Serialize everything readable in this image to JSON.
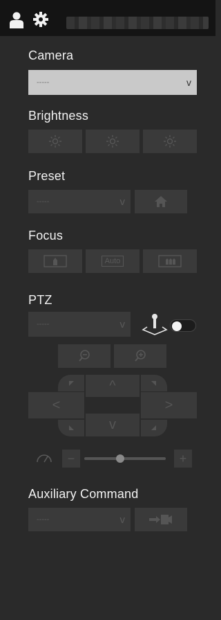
{
  "header": {
    "user_icon": "user-icon",
    "settings_icon": "gear-icon"
  },
  "camera": {
    "label": "Camera",
    "selected": "-----",
    "chevron": "v"
  },
  "brightness": {
    "label": "Brightness",
    "buttons": [
      "brightness-decrease",
      "brightness-reset",
      "brightness-increase"
    ]
  },
  "preset": {
    "label": "Preset",
    "selected": "-----",
    "chevron": "v",
    "home_icon": "home-icon"
  },
  "focus": {
    "label": "Focus",
    "auto_label": "Auto"
  },
  "ptz": {
    "label": "PTZ",
    "selected": "-----",
    "chevron": "v",
    "joystick_icon": "joystick-icon",
    "zoom_out_icon": "zoom-out-icon",
    "zoom_in_icon": "zoom-in-icon",
    "arrows": {
      "up": "^",
      "down": "v",
      "left": "<",
      "right": ">"
    },
    "speed_icon": "speedometer-icon",
    "minus": "−",
    "plus": "+",
    "speed_fraction": 0.44
  },
  "auxiliary": {
    "label": "Auxiliary Command",
    "selected": "-----",
    "chevron": "v",
    "send_icon": "send-command-icon"
  }
}
